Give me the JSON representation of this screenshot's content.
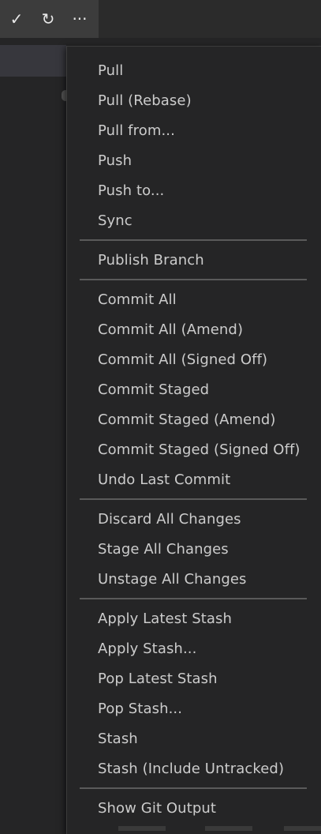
{
  "toolbar": {
    "commit_icon": "check-icon",
    "refresh_icon": "refresh-icon",
    "more_icon": "ellipsis-icon",
    "commit_glyph": "✓",
    "refresh_glyph": "↻",
    "more_glyph": "···"
  },
  "menu": {
    "groups": [
      [
        "Pull",
        "Pull (Rebase)",
        "Pull from...",
        "Push",
        "Push to...",
        "Sync"
      ],
      [
        "Publish Branch"
      ],
      [
        "Commit All",
        "Commit All (Amend)",
        "Commit All (Signed Off)",
        "Commit Staged",
        "Commit Staged (Amend)",
        "Commit Staged (Signed Off)",
        "Undo Last Commit"
      ],
      [
        "Discard All Changes",
        "Stage All Changes",
        "Unstage All Changes"
      ],
      [
        "Apply Latest Stash",
        "Apply Stash...",
        "Pop Latest Stash",
        "Pop Stash...",
        "Stash",
        "Stash (Include Untracked)"
      ],
      [
        "Show Git Output"
      ]
    ]
  }
}
